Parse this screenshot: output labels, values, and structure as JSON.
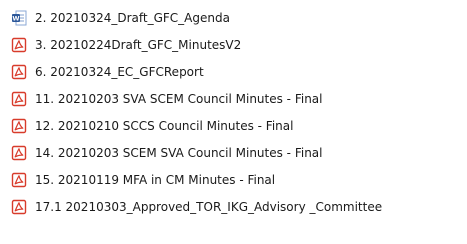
{
  "files": [
    {
      "name": "2. 20210324_Draft_GFC_Agenda",
      "icon": "word-document-icon"
    },
    {
      "name": "3. 20210224Draft_GFC_MinutesV2",
      "icon": "pdf-document-icon"
    },
    {
      "name": "6. 20210324_EC_GFCReport",
      "icon": "pdf-document-icon"
    },
    {
      "name": "11. 20210203 SVA SCEM Council Minutes - Final",
      "icon": "pdf-document-icon"
    },
    {
      "name": "12. 20210210 SCCS Council Minutes - Final",
      "icon": "pdf-document-icon"
    },
    {
      "name": "14. 20210203 SCEM SVA Council Minutes - Final",
      "icon": "pdf-document-icon"
    },
    {
      "name": "15. 20210119 MFA in CM Minutes - Final",
      "icon": "pdf-document-icon"
    },
    {
      "name": "17.1 20210303_Approved_TOR_IKG_Advisory _Committee",
      "icon": "pdf-document-icon"
    }
  ],
  "colors": {
    "word_blue": "#2b579a",
    "pdf_red": "#d83b2b",
    "text": "#1a1a1a"
  }
}
